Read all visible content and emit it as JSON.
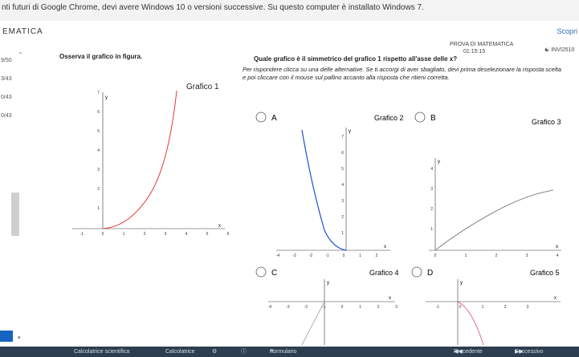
{
  "banner": {
    "text": "nti futuri di Google Chrome, devi avere Windows 10 o versioni successive. Su questo computer è installato Windows 7."
  },
  "topbar": {
    "app_name": "EMATICA",
    "stop_label": "Scopri"
  },
  "header": {
    "exam_title": "PROVA DI MATEMATICA",
    "timer": "01:15:15",
    "user_id": "INVI2510"
  },
  "sidebar": {
    "scores": [
      "9/50",
      "3/43",
      "0/43",
      "0/43"
    ],
    "collapse_icon": "chevron-up-icon"
  },
  "left_panel": {
    "prompt": "Osserva il grafico in figura.",
    "graph_label": "Grafico 1"
  },
  "question": {
    "text": "Quale grafico è il simmetrico del grafico 1 rispetto all'asse delle x?",
    "instructions_line1": "Per rispondere clicca su una delle alternative. Se ti accorgi di aver sbagliato, devi prima deselezionare la risposta scelta",
    "instructions_line2": "e poi cliccare con il mouse sul pallino accanto alla risposta che ritieni corretta."
  },
  "options": [
    {
      "letter": "A",
      "graph_label": "Grafico 2"
    },
    {
      "letter": "B",
      "graph_label": "Grafico 3"
    },
    {
      "letter": "C",
      "graph_label": "Grafico 4"
    },
    {
      "letter": "D",
      "graph_label": "Grafico 5"
    }
  ],
  "graph1": {
    "x_ticks": [
      "-1",
      "0",
      "1",
      "2",
      "3",
      "4",
      "5",
      "6"
    ],
    "y_ticks": [
      "1",
      "2",
      "3",
      "4",
      "5",
      "6",
      "7"
    ],
    "x_label": "x",
    "y_label": "y",
    "curve_color": "#e53935"
  },
  "graph2": {
    "x_ticks": [
      "-4",
      "-3",
      "-2",
      "-1",
      "0",
      "1",
      "2"
    ],
    "y_ticks": [
      "1",
      "2",
      "3",
      "4",
      "5",
      "6",
      "7"
    ],
    "x_label": "x",
    "y_label": "y",
    "curve_color": "#1e4fd8"
  },
  "graph3": {
    "x_ticks": [
      "0",
      "1",
      "2",
      "3",
      "4"
    ],
    "y_ticks": [
      "1",
      "2",
      "3",
      "4"
    ],
    "x_label": "x",
    "y_label": "y",
    "curve_color": "#8a8a8a"
  },
  "graph4": {
    "x_ticks": [
      "-4",
      "-3",
      "-2",
      "-1",
      "0",
      "1",
      "2",
      "3"
    ],
    "x_label": "x",
    "y_label": "y",
    "curve_color": "#b0b0b0"
  },
  "graph5": {
    "x_ticks": [
      "-1",
      "0",
      "1",
      "2",
      "3"
    ],
    "x_label": "x",
    "y_label": "y",
    "curve_color": "#e06aa6"
  },
  "footer": {
    "tab1": "Calcolatrice scientifica",
    "tab2": "Calcolatrice",
    "tab3": "Formulario",
    "prev_label": "Precedente",
    "next_label": "Successivo"
  }
}
